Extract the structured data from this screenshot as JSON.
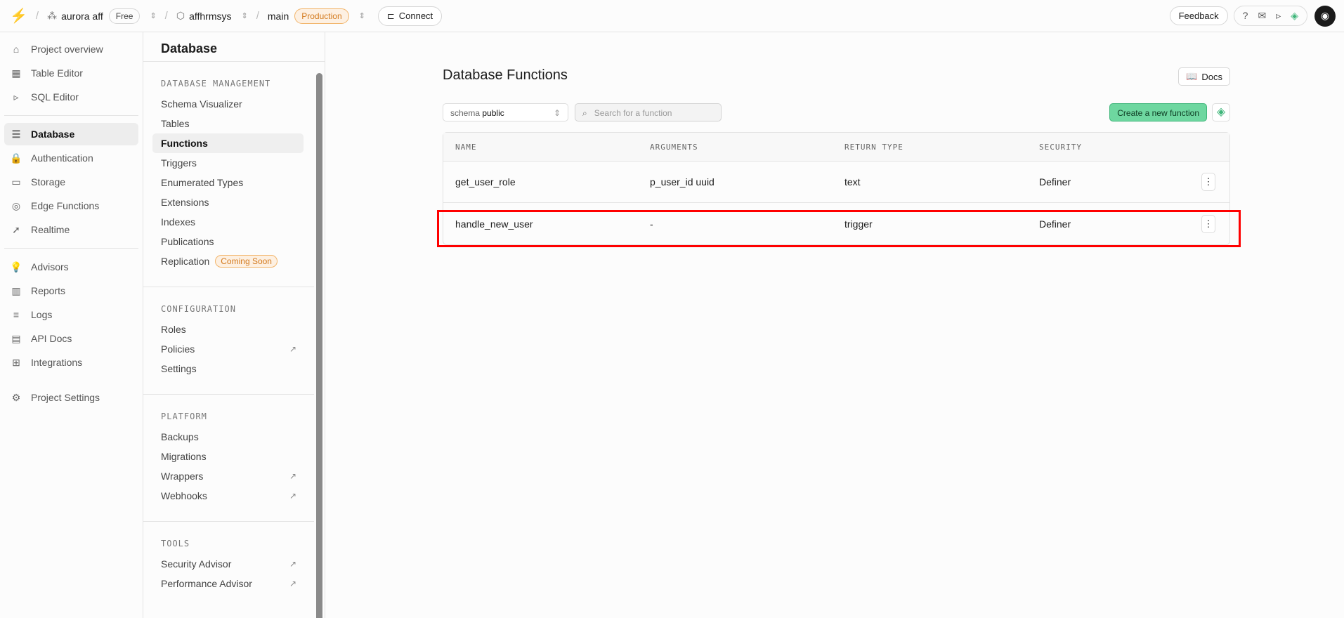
{
  "topbar": {
    "org": "aurora aff",
    "plan": "Free",
    "project": "affhrmsys",
    "branch": "main",
    "env": "Production",
    "connect": "Connect",
    "feedback": "Feedback"
  },
  "nav": {
    "items": [
      {
        "label": "Project overview",
        "icon": "⌂"
      },
      {
        "label": "Table Editor",
        "icon": "▦"
      },
      {
        "label": "SQL Editor",
        "icon": "▹"
      }
    ],
    "items2": [
      {
        "label": "Database",
        "icon": "☰"
      },
      {
        "label": "Authentication",
        "icon": "🔒"
      },
      {
        "label": "Storage",
        "icon": "▭"
      },
      {
        "label": "Edge Functions",
        "icon": "◎"
      },
      {
        "label": "Realtime",
        "icon": "➚"
      }
    ],
    "items3": [
      {
        "label": "Advisors",
        "icon": "💡"
      },
      {
        "label": "Reports",
        "icon": "▥"
      },
      {
        "label": "Logs",
        "icon": "≡"
      },
      {
        "label": "API Docs",
        "icon": "▤"
      },
      {
        "label": "Integrations",
        "icon": "⊞"
      }
    ],
    "settings": "Project Settings"
  },
  "side": {
    "title": "Database",
    "sec1": "DATABASE MANAGEMENT",
    "sec1_items": [
      "Schema Visualizer",
      "Tables",
      "Functions",
      "Triggers",
      "Enumerated Types",
      "Extensions",
      "Indexes",
      "Publications",
      "Replication"
    ],
    "coming_soon": "Coming Soon",
    "sec2": "CONFIGURATION",
    "sec2_items": [
      "Roles",
      "Policies",
      "Settings"
    ],
    "sec3": "PLATFORM",
    "sec3_items": [
      "Backups",
      "Migrations",
      "Wrappers",
      "Webhooks"
    ],
    "sec4": "TOOLS",
    "sec4_items": [
      "Security Advisor",
      "Performance Advisor"
    ]
  },
  "main": {
    "title": "Database Functions",
    "docs": "Docs",
    "schema_label": "schema",
    "schema_value": "public",
    "search_placeholder": "Search for a function",
    "create": "Create a new function",
    "columns": [
      "NAME",
      "ARGUMENTS",
      "RETURN TYPE",
      "SECURITY"
    ],
    "rows": [
      [
        "get_user_role",
        "p_user_id uuid",
        "text",
        "Definer"
      ],
      [
        "handle_new_user",
        "-",
        "trigger",
        "Definer"
      ]
    ]
  }
}
